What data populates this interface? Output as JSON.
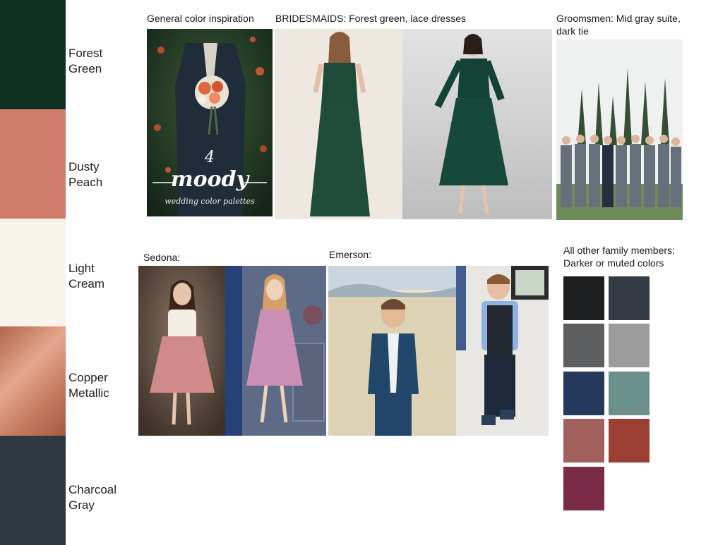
{
  "palette": [
    {
      "label_line1": "Forest",
      "label_line2": "Green",
      "color": "#0f3322"
    },
    {
      "label_line1": "Dusty",
      "label_line2": "Peach",
      "color": "#cf7d6a"
    },
    {
      "label_line1": "Light",
      "label_line2": "Cream",
      "color": "#faf3ea"
    },
    {
      "label_line1": "Copper",
      "label_line2": "Metallic",
      "color": "#c8816a"
    },
    {
      "label_line1": "Charcoal",
      "label_line2": "Gray",
      "color": "#303841"
    }
  ],
  "captions": {
    "general": "General color inspiration",
    "bridesmaids": "BRIDESMAIDS: Forest green, lace dresses",
    "groomsmen_line1": "Groomsmen: Mid gray suite,",
    "groomsmen_line2": "dark tie",
    "sedona": "Sedona:",
    "emerson": "Emerson:",
    "family_line1": "All other family members:",
    "family_line2": "Darker or muted colors"
  },
  "inspiration_card": {
    "number": "4",
    "title": "moody",
    "subtitle": "wedding color palettes"
  },
  "family_colors": [
    "#1c1e1f",
    "#343b45",
    "#5c5d5f",
    "#9c9c9c",
    "#24395c",
    "#6b908c",
    "#a3615d",
    "#9b3e33",
    "#7a2b47"
  ]
}
